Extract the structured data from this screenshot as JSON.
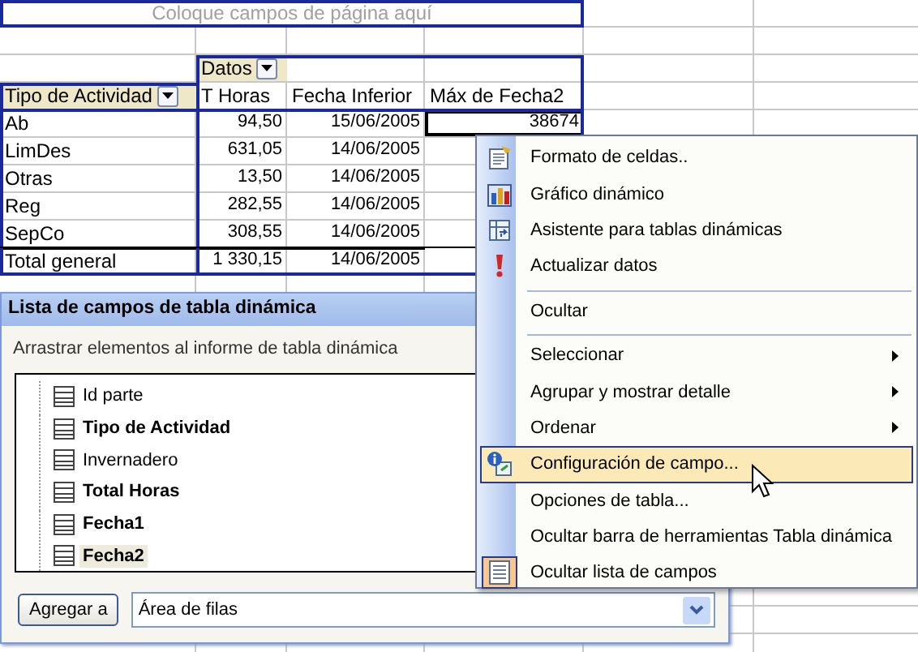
{
  "sheet": {
    "page_area": {
      "hint": "Coloque campos de página aquí"
    },
    "data_field": {
      "label": "Datos"
    },
    "row_field": {
      "label": "Tipo de Actividad"
    },
    "columns": [
      "T Horas",
      "Fecha Inferior",
      "Máx de Fecha2"
    ],
    "rows": [
      {
        "label": "Ab",
        "cells": [
          "94,50",
          "15/06/2005",
          "38674"
        ],
        "active": true,
        "total": false
      },
      {
        "label": "LimDes",
        "cells": [
          "631,05",
          "14/06/2005"
        ],
        "active": false,
        "total": false
      },
      {
        "label": "Otras",
        "cells": [
          "13,50",
          "14/06/2005"
        ],
        "active": false,
        "total": false
      },
      {
        "label": "Reg",
        "cells": [
          "282,55",
          "14/06/2005"
        ],
        "active": false,
        "total": false
      },
      {
        "label": "SepCo",
        "cells": [
          "308,55",
          "14/06/2005"
        ],
        "active": false,
        "total": false
      },
      {
        "label": "Total general",
        "cells": [
          "1 330,15",
          "14/06/2005"
        ],
        "active": false,
        "total": true
      }
    ]
  },
  "field_list": {
    "title": "Lista de campos de tabla dinámica",
    "instruction": "Arrastrar elementos al informe de tabla dinámica",
    "fields": [
      {
        "label": "Id parte",
        "in_report": false,
        "selected": false
      },
      {
        "label": "Tipo de Actividad",
        "in_report": true,
        "selected": false
      },
      {
        "label": "Invernadero",
        "in_report": false,
        "selected": false
      },
      {
        "label": "Total Horas",
        "in_report": true,
        "selected": false
      },
      {
        "label": "Fecha1",
        "in_report": true,
        "selected": false
      },
      {
        "label": "Fecha2",
        "in_report": true,
        "selected": true
      }
    ],
    "add_button": "Agregar a",
    "area": {
      "value": "Área de filas"
    }
  },
  "context_menu": [
    {
      "label": "Formato de celdas..",
      "separator_before": false,
      "submenu": false,
      "highlighted": false,
      "checked": false
    },
    {
      "label": "Gráfico dinámico",
      "separator_before": false,
      "submenu": false,
      "highlighted": false,
      "checked": false
    },
    {
      "label": "Asistente para tablas dinámicas",
      "separator_before": false,
      "submenu": false,
      "highlighted": false,
      "checked": false
    },
    {
      "label": "Actualizar datos",
      "separator_before": false,
      "submenu": false,
      "highlighted": false,
      "checked": false
    },
    {
      "label": "Ocultar",
      "separator_before": true,
      "submenu": false,
      "highlighted": false,
      "checked": false
    },
    {
      "label": "Seleccionar",
      "separator_before": true,
      "submenu": true,
      "highlighted": false,
      "checked": false
    },
    {
      "label": "Agrupar y mostrar detalle",
      "separator_before": false,
      "submenu": true,
      "highlighted": false,
      "checked": false
    },
    {
      "label": "Ordenar",
      "separator_before": false,
      "submenu": true,
      "highlighted": false,
      "checked": false
    },
    {
      "label": "Configuración de campo...",
      "separator_before": false,
      "submenu": false,
      "highlighted": true,
      "checked": false
    },
    {
      "label": "Opciones de tabla...",
      "separator_before": false,
      "submenu": false,
      "highlighted": false,
      "checked": false
    },
    {
      "label": "Ocultar barra de herramientas Tabla dinámica",
      "separator_before": false,
      "submenu": false,
      "highlighted": false,
      "checked": false
    },
    {
      "label": "Ocultar lista de campos",
      "separator_before": false,
      "submenu": false,
      "highlighted": false,
      "checked": true
    }
  ]
}
